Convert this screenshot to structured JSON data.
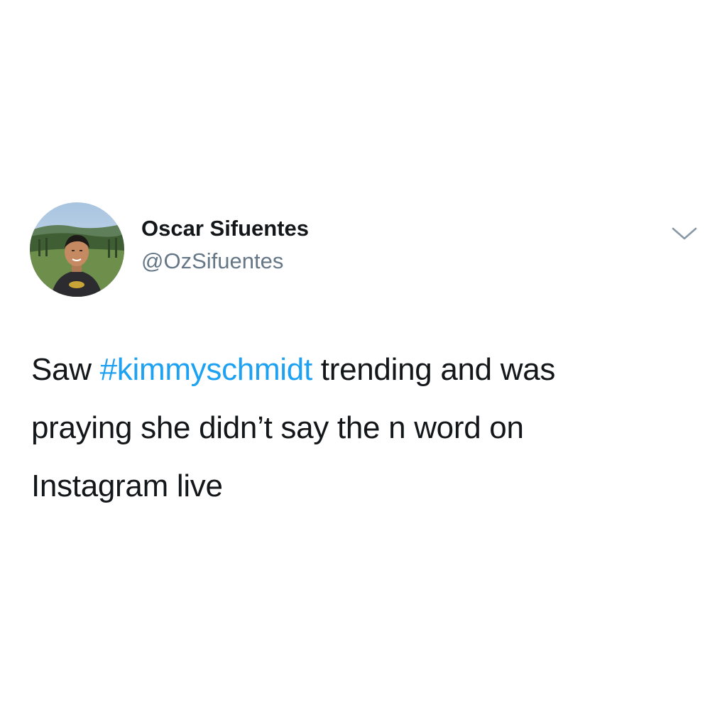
{
  "tweet": {
    "author": {
      "display_name": "Oscar Sifuentes",
      "handle": "@OzSifuentes",
      "avatar_icon": "profile-photo"
    },
    "menu_icon": "chevron-down-icon",
    "text": {
      "line1_before": "Saw ",
      "hashtag": "#kimmyschmidt",
      "line1_after": " trending and was",
      "line2": "praying she didn’t say the n word on",
      "line3": "Instagram live"
    },
    "colors": {
      "text": "#14171a",
      "handle": "#657786",
      "hashtag": "#1da1f2",
      "chevron": "#8899a6"
    }
  }
}
